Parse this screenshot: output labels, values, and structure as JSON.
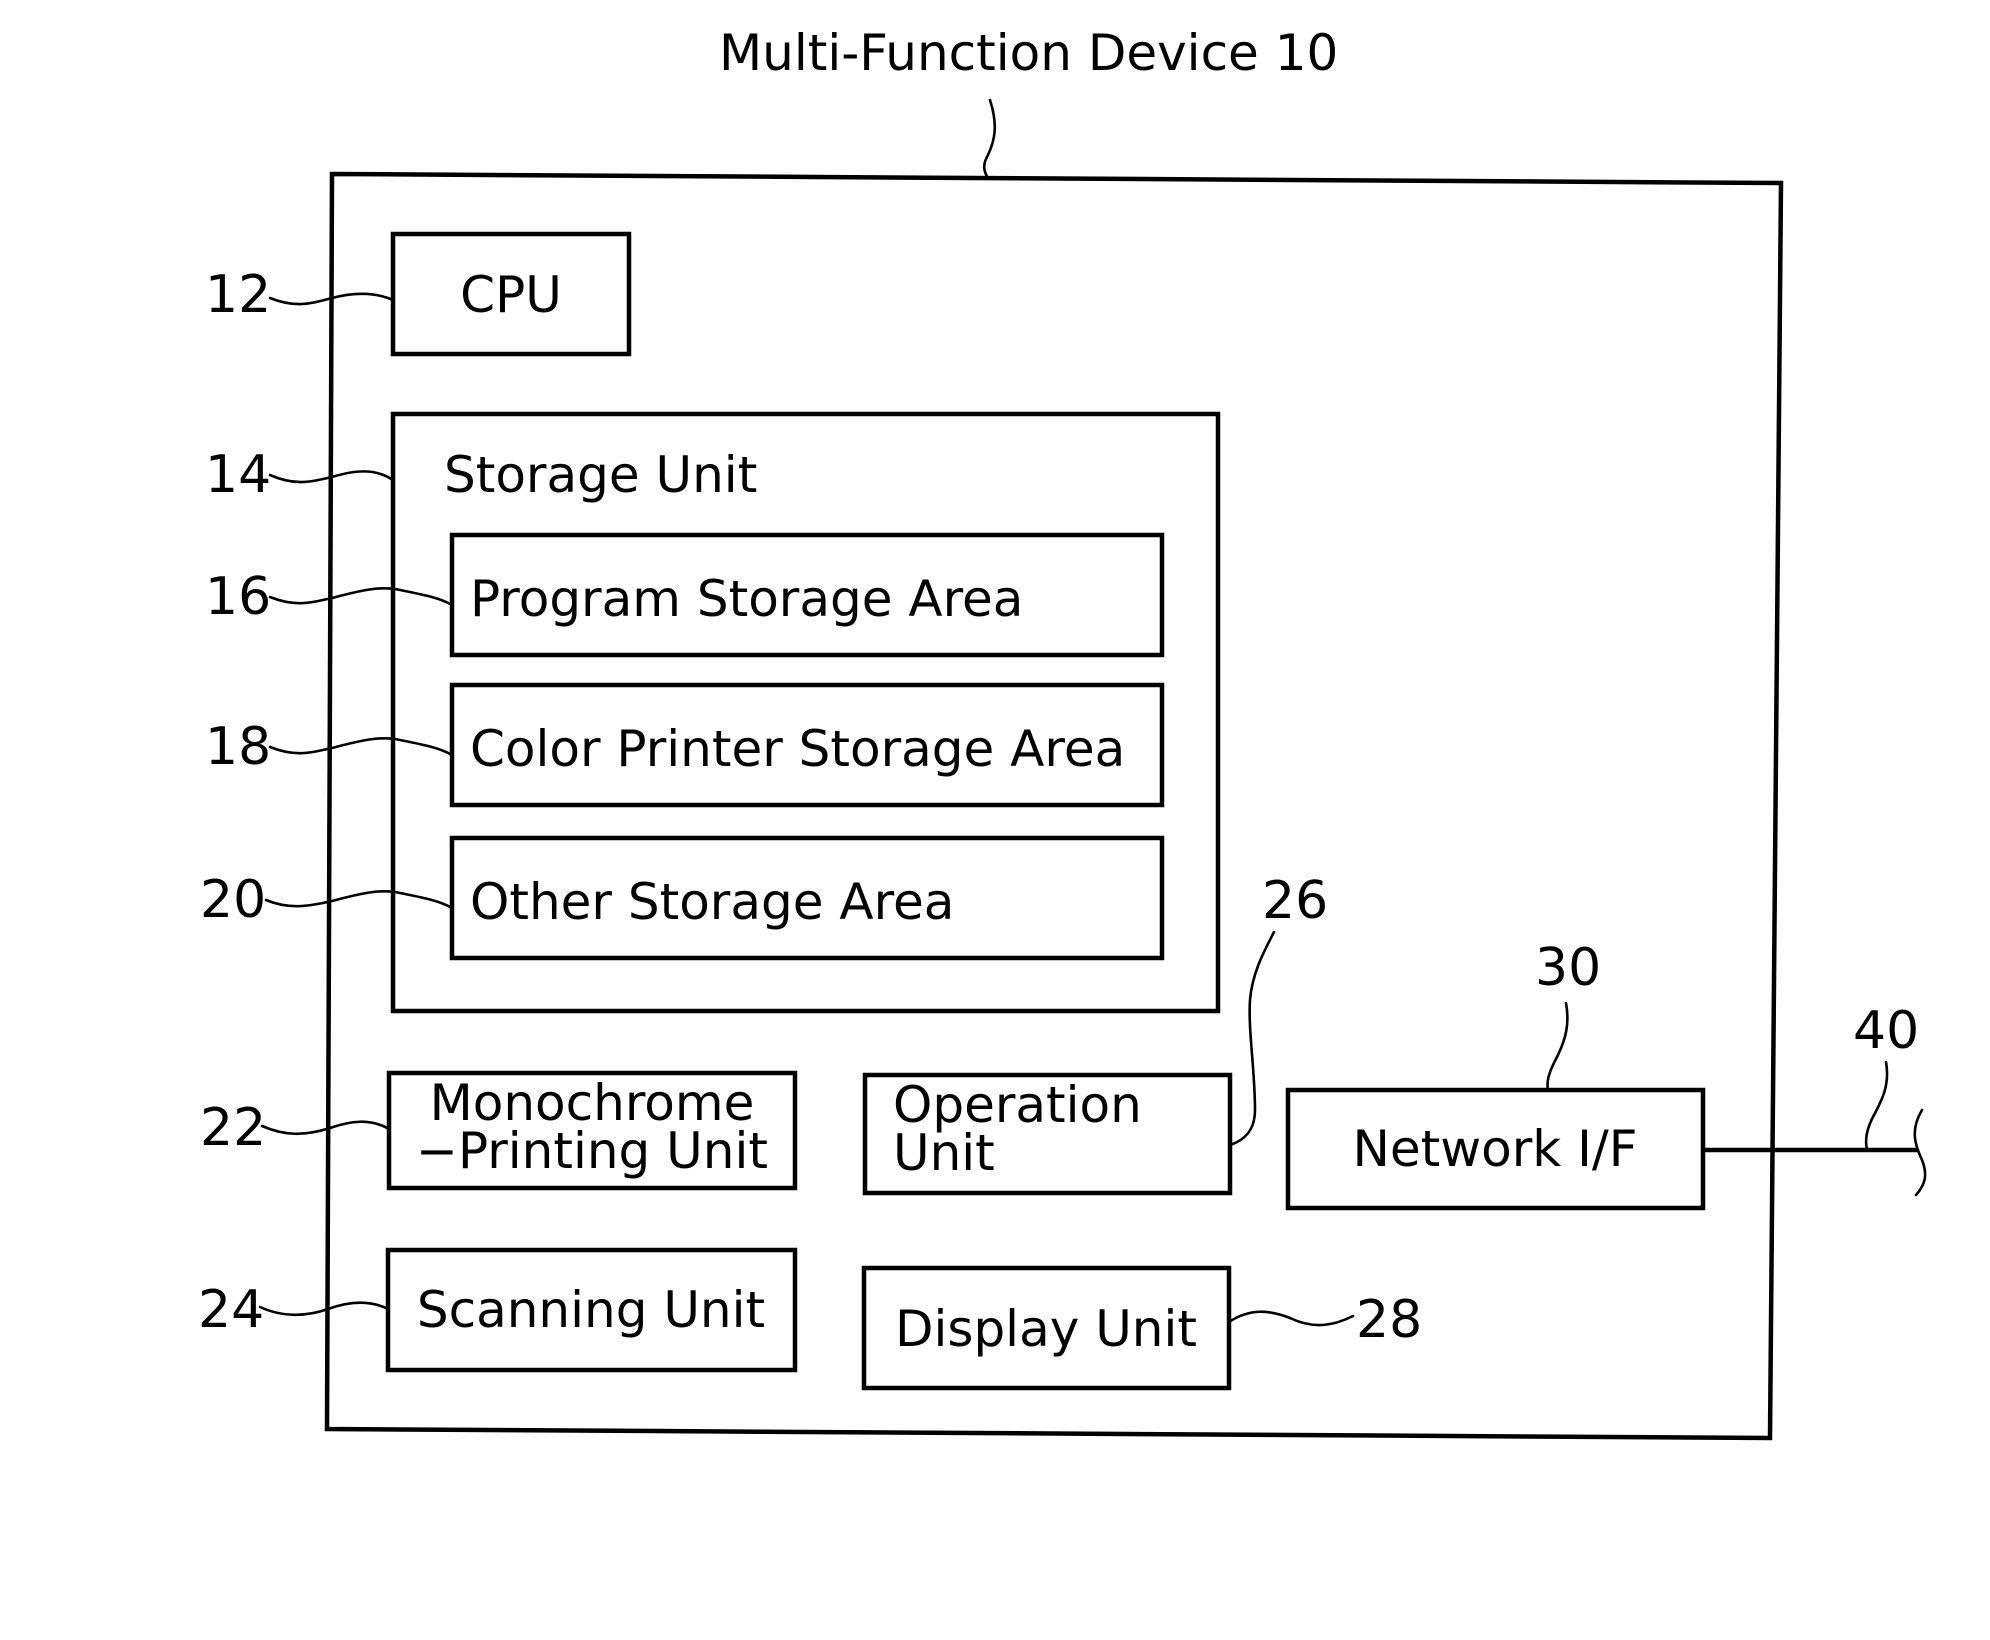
{
  "diagram": {
    "title": "Multi-Function Device 10",
    "components": {
      "cpu": {
        "ref": "12",
        "label": "CPU"
      },
      "storage_unit": {
        "ref": "14",
        "label": "Storage Unit"
      },
      "program_storage_area": {
        "ref": "16",
        "label": "Program Storage Area"
      },
      "color_printer_storage_area": {
        "ref": "18",
        "label": "Color Printer Storage Area"
      },
      "other_storage_area": {
        "ref": "20",
        "label": "Other Storage Area"
      },
      "monochrome_printing_unit": {
        "ref": "22",
        "label_line1": "Monochrome",
        "label_line2": "−Printing Unit"
      },
      "scanning_unit": {
        "ref": "24",
        "label": "Scanning Unit"
      },
      "operation_unit": {
        "ref": "26",
        "label_line1": "Operation",
        "label_line2": "Unit"
      },
      "display_unit": {
        "ref": "28",
        "label": "Display Unit"
      },
      "network_if": {
        "ref": "30",
        "label": "Network I/F"
      },
      "network": {
        "ref": "40"
      }
    }
  }
}
